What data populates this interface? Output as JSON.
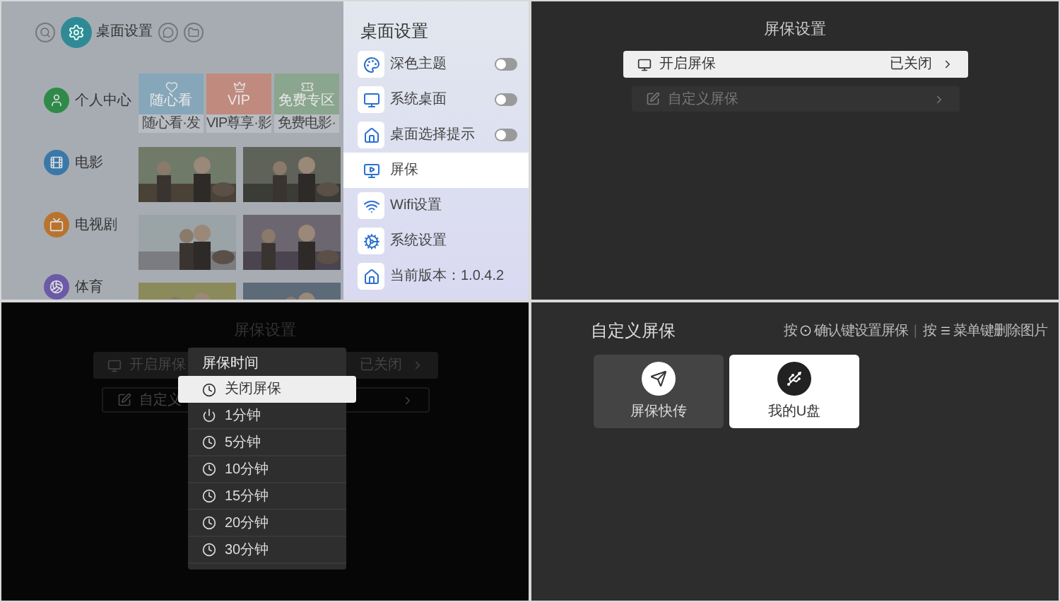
{
  "home_screen": {
    "top_bar": [
      {
        "kind": "search",
        "selected": false
      },
      {
        "kind": "settings",
        "selected": true,
        "label": "桌面设置"
      },
      {
        "kind": "message",
        "selected": false
      },
      {
        "kind": "folder",
        "selected": false
      }
    ],
    "nav": [
      {
        "kind": "user",
        "label": "个人中心",
        "color": "#2f8a4a"
      },
      {
        "kind": "film",
        "label": "电影",
        "color": "#3a78a8"
      },
      {
        "kind": "tv",
        "label": "电视剧",
        "color": "#b8742e"
      },
      {
        "kind": "sport",
        "label": "体育",
        "color": "#6a5aa8"
      }
    ],
    "tiles": [
      {
        "kind": "heart",
        "title": "随心看",
        "caption": "随心看·发",
        "color": "#86a7b9"
      },
      {
        "kind": "crown",
        "title": "VIP",
        "caption": "VIP尊享·影",
        "color": "#c08a7e"
      },
      {
        "kind": "ticket",
        "title": "免费专区",
        "caption": "免费电影·",
        "color": "#8aa68e"
      }
    ],
    "settings_panel": {
      "title": "桌面设置",
      "items": [
        {
          "kind": "theme",
          "label": "深色主题",
          "selected": false,
          "toggle": {
            "on": false
          }
        },
        {
          "kind": "desktop",
          "label": "系统桌面",
          "selected": false,
          "toggle": {
            "on": false
          }
        },
        {
          "kind": "home",
          "label": "桌面选择提示",
          "selected": false,
          "toggle": {
            "on": false
          }
        },
        {
          "kind": "screen",
          "label": "屏保",
          "selected": true
        },
        {
          "kind": "wifi",
          "label": "Wifi设置",
          "selected": false
        },
        {
          "kind": "gear",
          "label": "系统设置",
          "selected": false
        },
        {
          "kind": "home",
          "label": "当前版本：1.0.4.2",
          "selected": false
        }
      ]
    }
  },
  "screensaver_settings": {
    "title": "屏保设置",
    "items": [
      {
        "kind": "monitor",
        "label": "开启屏保",
        "value": "已关闭",
        "selected": true
      },
      {
        "kind": "edit",
        "label": "自定义屏保",
        "selected": false
      }
    ]
  },
  "timeout_dialog": {
    "backdrop": {
      "title": "屏保设置",
      "items": [
        {
          "kind": "monitor",
          "label": "开启屏保",
          "value": "已关闭"
        },
        {
          "kind": "edit",
          "label": "自定义"
        }
      ]
    },
    "title": "屏保时间",
    "options": [
      {
        "kind": "clock",
        "label": "关闭屏保",
        "selected": true
      },
      {
        "kind": "power",
        "label": "1分钟",
        "selected": false
      },
      {
        "kind": "clock",
        "label": "5分钟",
        "selected": false
      },
      {
        "kind": "clock",
        "label": "10分钟",
        "selected": false
      },
      {
        "kind": "clock",
        "label": "15分钟",
        "selected": false
      },
      {
        "kind": "clock",
        "label": "20分钟",
        "selected": false
      },
      {
        "kind": "clock",
        "label": "30分钟",
        "selected": false
      }
    ]
  },
  "custom_screensaver": {
    "title": "自定义屏保",
    "hint": [
      {
        "kind": "text",
        "text": "按"
      },
      {
        "kind": "ok_key"
      },
      {
        "kind": "text",
        "text": "确认键设置屏保"
      },
      {
        "kind": "separator",
        "text": "|"
      },
      {
        "kind": "text",
        "text": "按"
      },
      {
        "kind": "menu_key"
      },
      {
        "kind": "text",
        "text": "菜单键删除图片"
      }
    ],
    "cards": [
      {
        "kind": "send",
        "label": "屏保快传",
        "selected": false
      },
      {
        "kind": "usb",
        "label": "我的U盘",
        "selected": true
      }
    ]
  }
}
